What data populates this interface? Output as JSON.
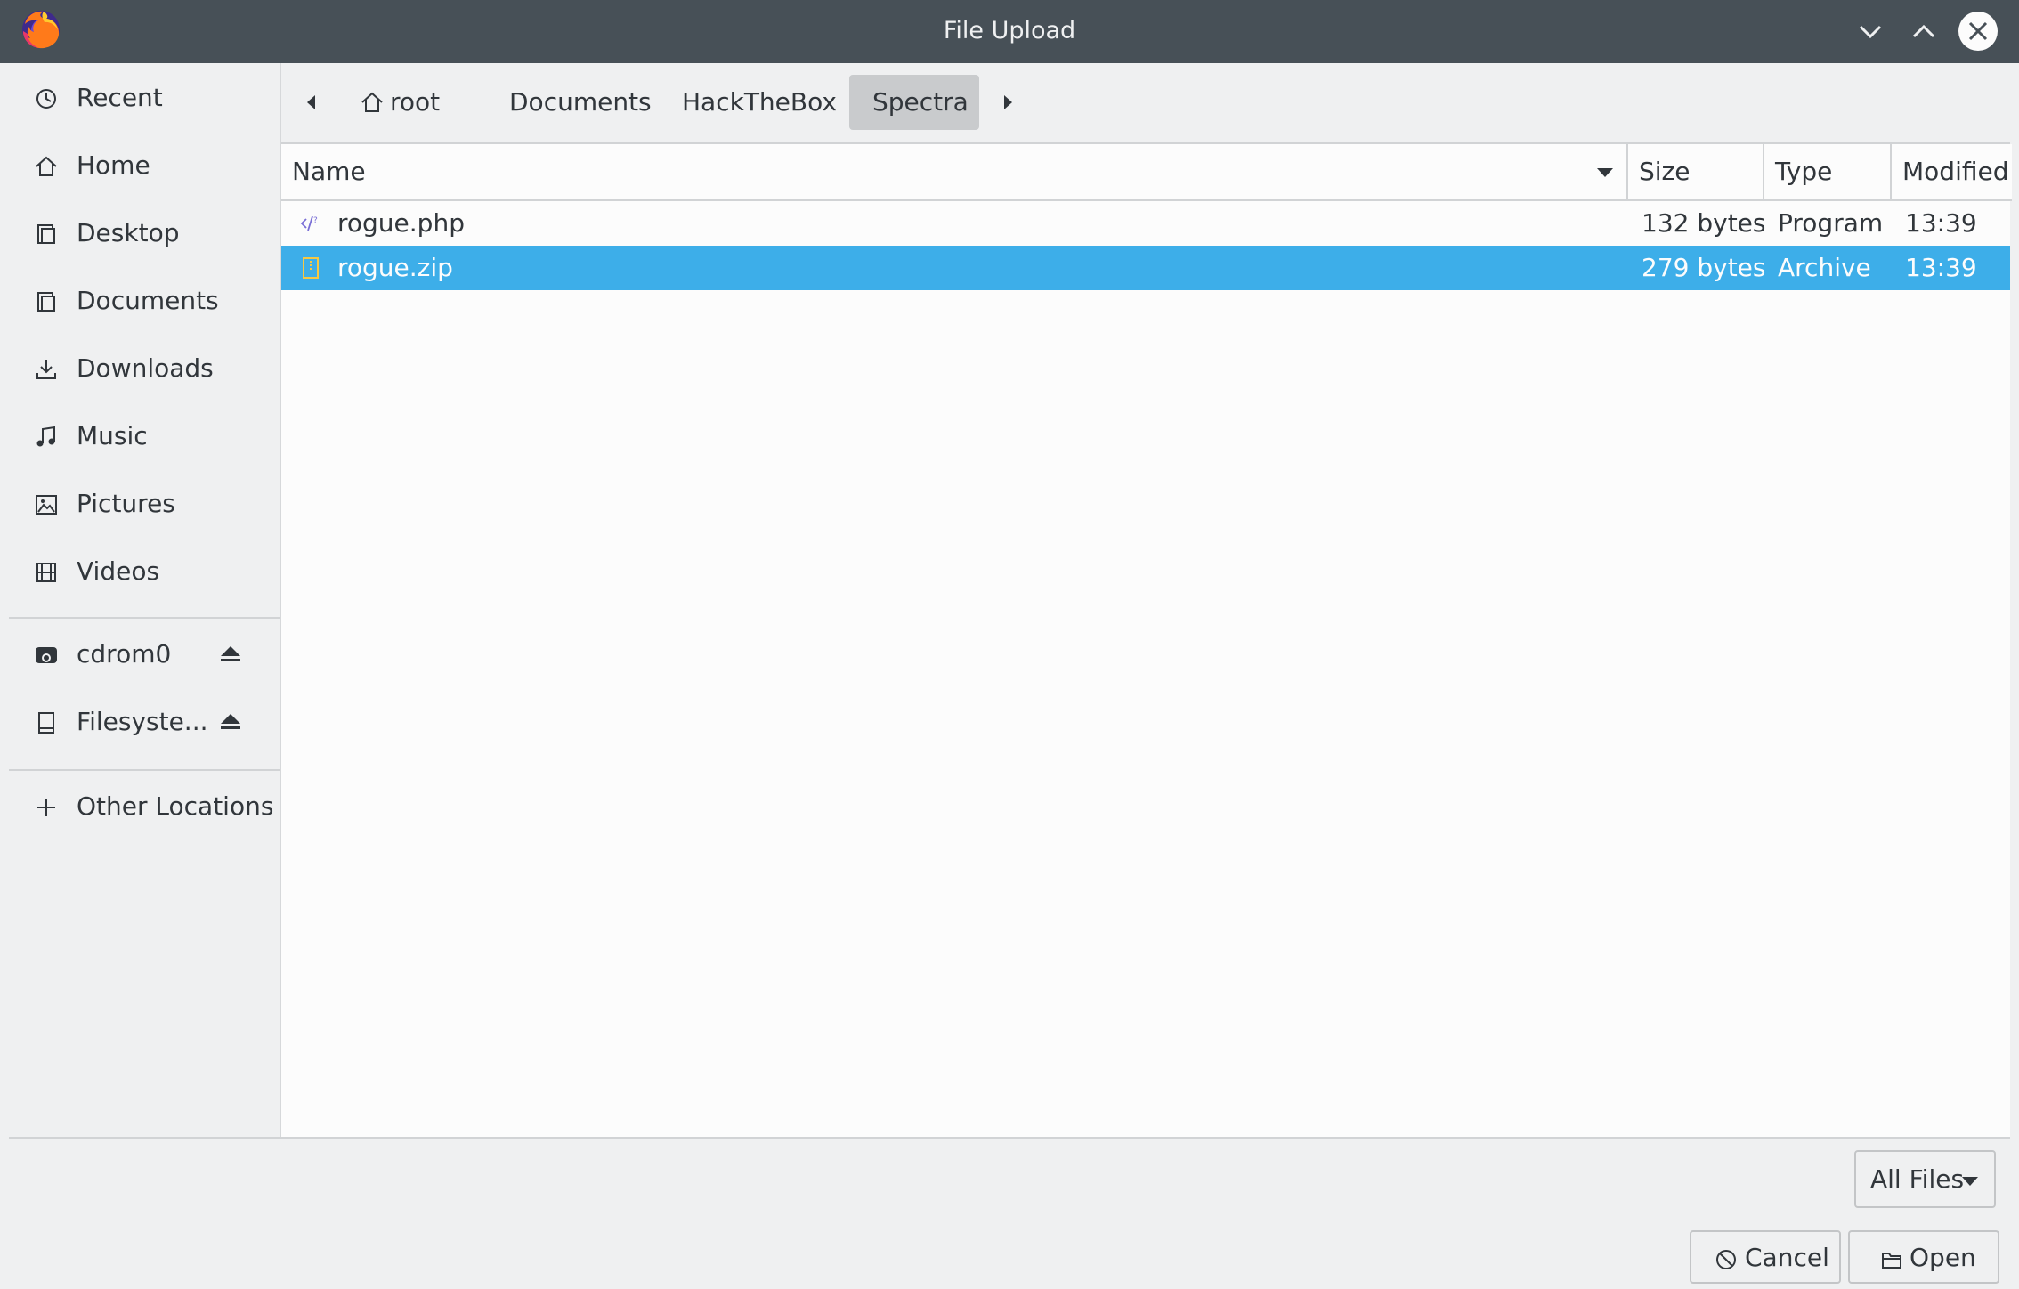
{
  "window": {
    "title": "File Upload",
    "app_icon": "firefox-logo-icon",
    "controls": [
      "minimize-chevron-down-icon",
      "maximize-chevron-up-icon",
      "close-icon"
    ]
  },
  "sidebar": {
    "places": [
      {
        "label": "Recent",
        "icon": "clock-icon"
      },
      {
        "label": "Home",
        "icon": "home-icon"
      },
      {
        "label": "Desktop",
        "icon": "desktop-icon"
      },
      {
        "label": "Documents",
        "icon": "documents-icon"
      },
      {
        "label": "Downloads",
        "icon": "download-icon"
      },
      {
        "label": "Music",
        "icon": "music-note-icon"
      },
      {
        "label": "Pictures",
        "icon": "picture-icon"
      },
      {
        "label": "Videos",
        "icon": "film-icon"
      }
    ],
    "devices": [
      {
        "label": "cdrom0",
        "icon": "optical-drive-icon",
        "eject": true
      },
      {
        "label": "Filesyste...",
        "icon": "hard-drive-icon",
        "eject": true
      }
    ],
    "other": {
      "label": "Other Locations",
      "icon": "plus-icon"
    }
  },
  "pathbar": {
    "crumbs": [
      "root",
      "Documents",
      "HackTheBox",
      "Spectra"
    ],
    "active": "Spectra"
  },
  "filelist": {
    "columns": {
      "name": "Name",
      "size": "Size",
      "type": "Type",
      "modified": "Modified"
    },
    "rows": [
      {
        "name": "rogue.php",
        "size": "132 bytes",
        "type": "Program",
        "modified": "13:39",
        "icon": "code-file-icon",
        "selected": false
      },
      {
        "name": "rogue.zip",
        "size": "279 bytes",
        "type": "Archive",
        "modified": "13:39",
        "icon": "archive-file-icon",
        "selected": true
      }
    ]
  },
  "footer": {
    "filter_label": "All Files",
    "cancel_label": "Cancel",
    "open_label": "Open"
  },
  "colors": {
    "titlebar": "#475057",
    "selection": "#3daee9",
    "background": "#eff0f1",
    "view": "#fcfcfc"
  }
}
